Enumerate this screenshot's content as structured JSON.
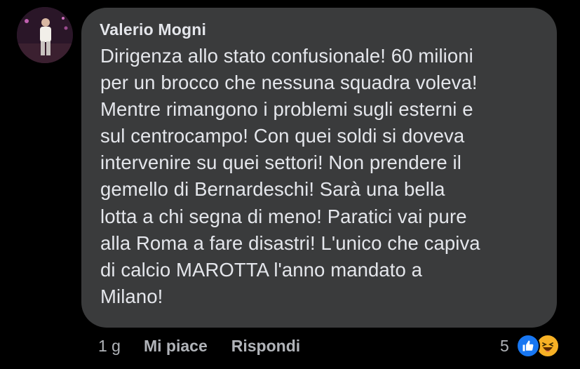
{
  "comment": {
    "author": "Valerio Mogni",
    "text": "Dirigenza allo stato confusionale! 60 milioni\nper un brocco che nessuna squadra voleva!\nMentre rimangono i problemi sugli esterni e\nsul centrocampo! Con quei soldi si doveva\nintervenire su quei settori! Non prendere il\ngemello di Bernardeschi! Sarà  una bella\nlotta a chi segna di meno! Paratici vai pure\nalla Roma a fare disastri! L'unico che capiva\ndi calcio MAROTTA l'anno mandato a\nMilano!",
    "time": "1 g",
    "like_label": "Mi piace",
    "reply_label": "Rispondi",
    "reaction_count": "5",
    "reaction_icons": [
      "like-reaction-icon",
      "haha-reaction-icon"
    ]
  },
  "colors": {
    "background": "#000000",
    "bubble": "#3a3b3c",
    "text": "#e4e6eb",
    "secondary_text": "#b0b3b8",
    "like_blue": "#1877f2",
    "haha_yellow": "#f7b125"
  }
}
